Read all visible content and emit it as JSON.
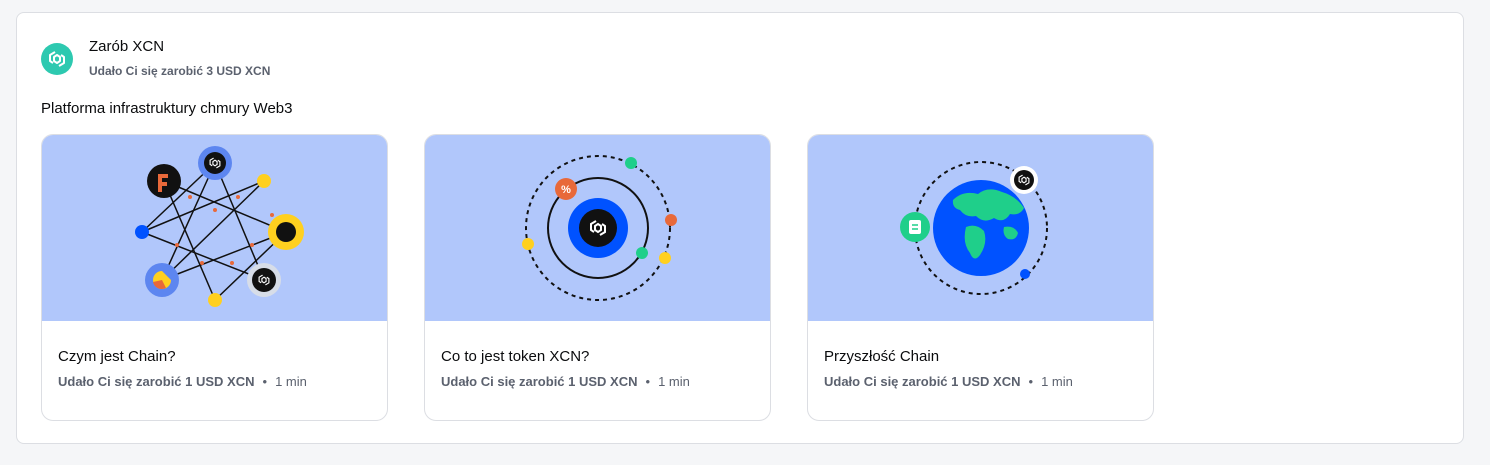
{
  "header": {
    "title": "Zarób XCN",
    "subtitle": "Udało Ci się zarobić 3 USD XCN",
    "logo_icon": "chain-logo-icon"
  },
  "section": {
    "title": "Platforma infrastruktury chmury Web3"
  },
  "cards": [
    {
      "title": "Czym jest Chain?",
      "reward": "Udało Ci się zarobić 1 USD XCN",
      "separator": "•",
      "duration": "1 min",
      "illustration": "network-nodes-illustration"
    },
    {
      "title": "Co to jest token XCN?",
      "reward": "Udało Ci się zarobić 1 USD XCN",
      "separator": "•",
      "duration": "1 min",
      "illustration": "orbit-token-illustration"
    },
    {
      "title": "Przyszłość Chain",
      "reward": "Udało Ci się zarobić 1 USD XCN",
      "separator": "•",
      "duration": "1 min",
      "illustration": "globe-illustration"
    }
  ],
  "colors": {
    "accent_teal": "#2dc9b0",
    "card_image_bg": "#b1c7fb",
    "blue": "#0052ff",
    "yellow": "#ffd01f",
    "orange": "#e8693a",
    "green": "#1fcf8a"
  }
}
